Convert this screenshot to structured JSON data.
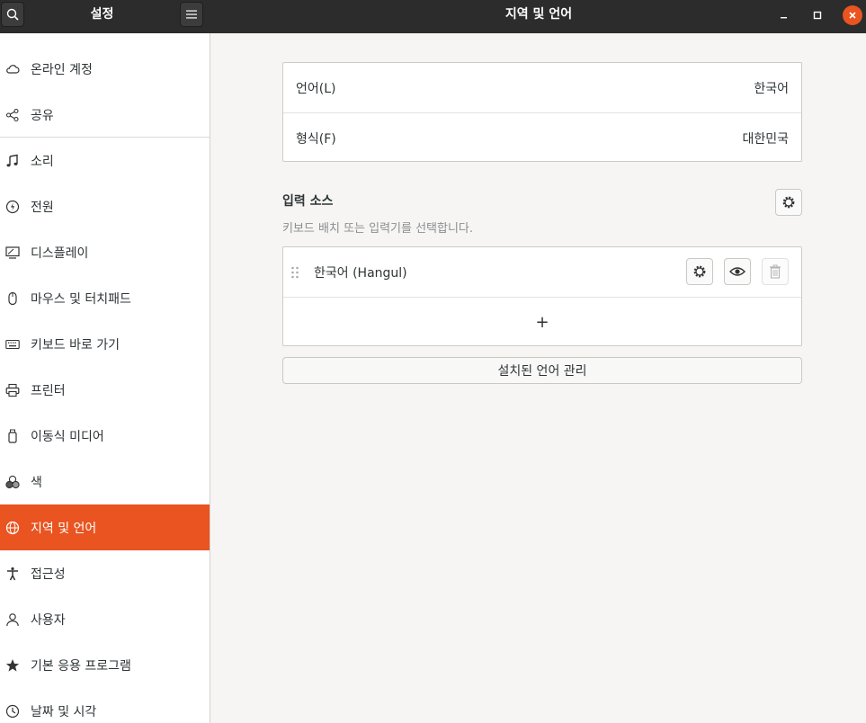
{
  "header": {
    "left_title": "설정",
    "title": "지역 및 언어"
  },
  "sidebar": {
    "items": [
      {
        "label": "온라인 계정",
        "icon": "cloud-icon"
      },
      {
        "label": "공유",
        "icon": "share-icon"
      },
      {
        "label": "소리",
        "icon": "music-note-icon"
      },
      {
        "label": "전원",
        "icon": "power-icon"
      },
      {
        "label": "디스플레이",
        "icon": "display-icon"
      },
      {
        "label": "마우스 및 터치패드",
        "icon": "mouse-icon"
      },
      {
        "label": "키보드 바로 가기",
        "icon": "keyboard-icon"
      },
      {
        "label": "프린터",
        "icon": "printer-icon"
      },
      {
        "label": "이동식 미디어",
        "icon": "removable-media-icon"
      },
      {
        "label": "색",
        "icon": "color-icon"
      },
      {
        "label": "지역 및 언어",
        "icon": "globe-icon",
        "active": true
      },
      {
        "label": "접근성",
        "icon": "accessibility-icon"
      },
      {
        "label": "사용자",
        "icon": "user-icon"
      },
      {
        "label": "기본 응용 프로그램",
        "icon": "star-icon"
      },
      {
        "label": "날짜 및 시각",
        "icon": "clock-icon"
      }
    ]
  },
  "main": {
    "language_label": "언어(L)",
    "language_value": "한국어",
    "formats_label": "형식(F)",
    "formats_value": "대한민국",
    "input_sources": {
      "title": "입력 소스",
      "subtitle": "키보드 배치 또는 입력기를 선택합니다.",
      "items": [
        {
          "label": "한국어 (Hangul)"
        }
      ],
      "add_label": "+"
    },
    "manage_button": "설치된 언어 관리"
  },
  "colors": {
    "accent": "#e95420",
    "headerbar": "#2c2c2c"
  }
}
